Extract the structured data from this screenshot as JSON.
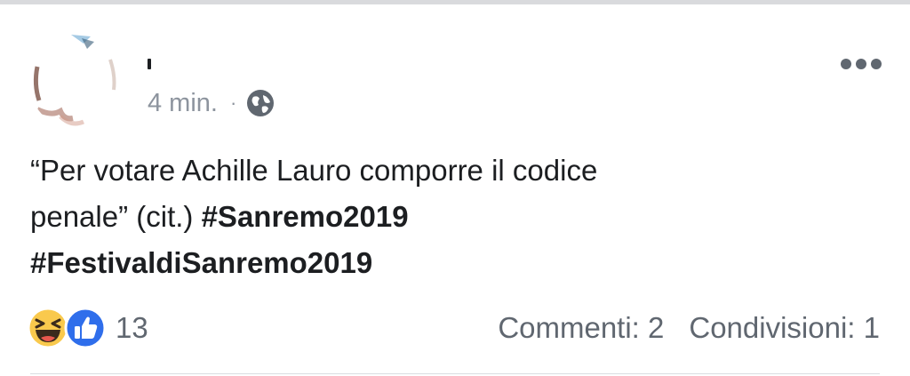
{
  "post": {
    "timestamp": "4 min.",
    "separator": "·",
    "privacy_icon": "globe-icon",
    "options_icon": "more-horizontal-icon",
    "text": {
      "line1": "“Per votare Achille Lauro comporre il codice",
      "line2_prefix": "penale” (cit.) ",
      "hashtag1": "#Sanremo2019",
      "hashtag2": "#FestivaldiSanremo2019"
    },
    "reactions": {
      "icons": [
        "laughing-emoji-icon",
        "like-thumb-icon"
      ],
      "count": "13"
    },
    "stats": {
      "comments": "Commenti: 2",
      "shares": "Condivisioni: 1"
    }
  },
  "colors": {
    "text_primary": "#1c1e21",
    "text_secondary": "#606770",
    "meta": "#8d949e",
    "like_blue": "#2f6eeb",
    "haha_yellow": "#f9c94d",
    "divider": "#dadde1"
  }
}
